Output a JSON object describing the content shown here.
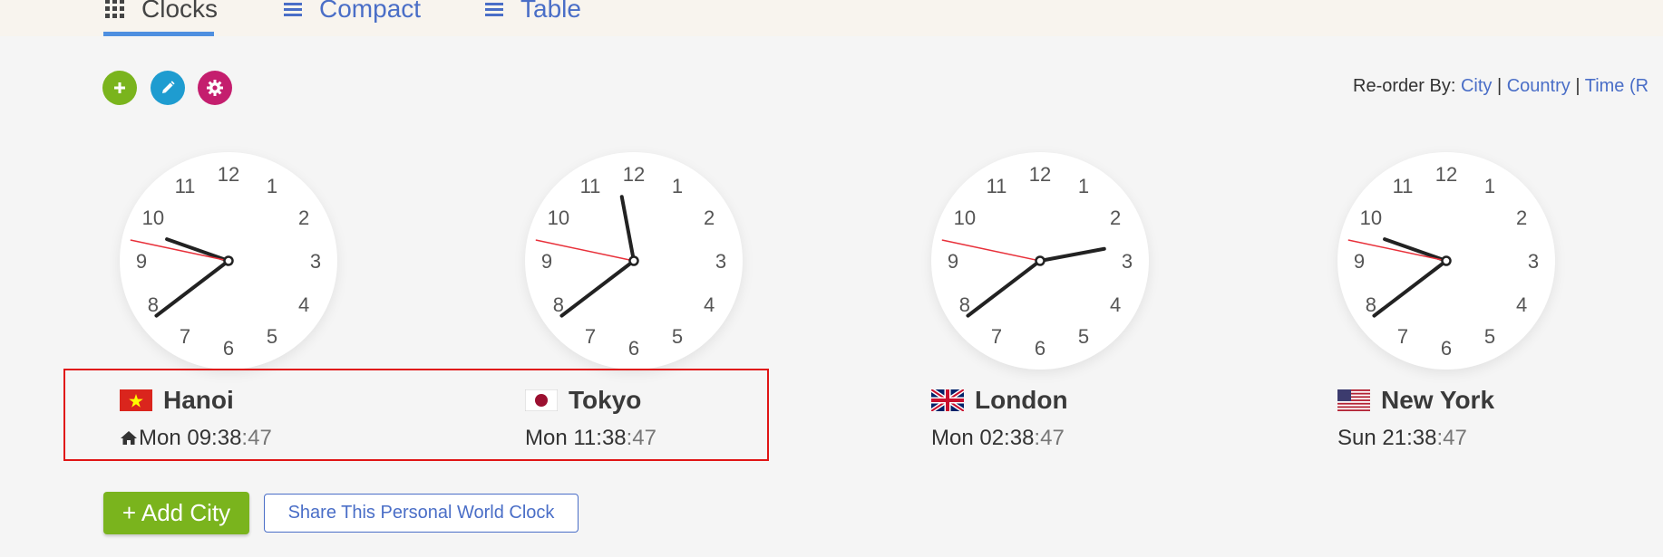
{
  "tabs": [
    {
      "label": "Clocks",
      "icon": "grid-icon",
      "active": true
    },
    {
      "label": "Compact",
      "icon": "list-icon",
      "active": false
    },
    {
      "label": "Table",
      "icon": "list-icon",
      "active": false
    }
  ],
  "toolbar": {
    "add_icon": "plus-icon",
    "edit_icon": "pencil-icon",
    "settings_icon": "gear-icon"
  },
  "reorder": {
    "label": "Re-order By:",
    "options": [
      "City",
      "Country",
      "Time"
    ],
    "separator": "|",
    "trailing": "(R"
  },
  "clock_numbers": [
    "12",
    "1",
    "2",
    "3",
    "4",
    "5",
    "6",
    "7",
    "8",
    "9",
    "10",
    "11"
  ],
  "clocks": [
    {
      "city": "Hanoi",
      "flag": "vietnam-flag",
      "home": true,
      "day": "Mon",
      "hm": "09:38",
      "sec": ":47",
      "hour": 9,
      "minute": 38,
      "second": 47
    },
    {
      "city": "Tokyo",
      "flag": "japan-flag",
      "home": false,
      "day": "Mon",
      "hm": "11:38",
      "sec": ":47",
      "hour": 11,
      "minute": 38,
      "second": 47
    },
    {
      "city": "London",
      "flag": "uk-flag",
      "home": false,
      "day": "Mon",
      "hm": "02:38",
      "sec": ":47",
      "hour": 2,
      "minute": 38,
      "second": 47
    },
    {
      "city": "New York",
      "flag": "usa-flag",
      "home": false,
      "day": "Sun",
      "hm": "21:38",
      "sec": ":47",
      "hour": 21,
      "minute": 38,
      "second": 47
    }
  ],
  "actions": {
    "add_city": "+ Add City",
    "share": "Share This Personal World Clock"
  },
  "colors": {
    "accent_green": "#7ab41d",
    "accent_blue": "#1e9cd0",
    "accent_magenta": "#c41e6e",
    "link": "#4a6ec7",
    "second_hand": "#e8303a",
    "highlight": "#e01515"
  }
}
